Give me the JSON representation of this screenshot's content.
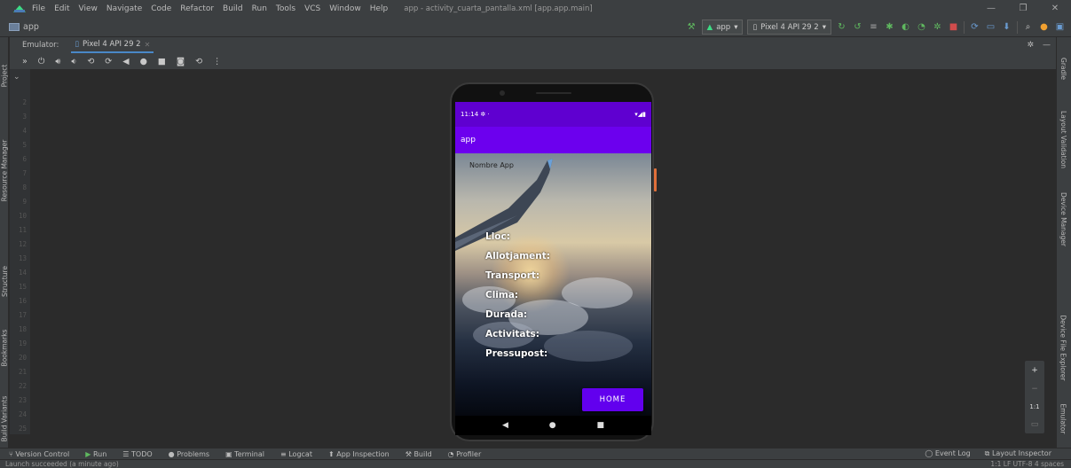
{
  "menubar": {
    "items": [
      "File",
      "Edit",
      "View",
      "Navigate",
      "Code",
      "Refactor",
      "Build",
      "Run",
      "Tools",
      "VCS",
      "Window",
      "Help"
    ],
    "window_title": "app - activity_cuarta_pantalla.xml [app.app.main]",
    "minimize": "—",
    "maximize": "❐",
    "close": "✕"
  },
  "navbar": {
    "project": "app",
    "run_config": "app",
    "device": "Pixel 4 API 29 2"
  },
  "left_tabs": [
    "Project",
    "Resource Manager",
    "Structure",
    "Bookmarks",
    "Build Variants"
  ],
  "right_tabs": [
    "Gradle",
    "Layout Validation",
    "Device Manager",
    "Device File Explorer",
    "Emulator"
  ],
  "emulator_tab": {
    "label": "Emulator:",
    "device_tab": "Pixel 4 API 29 2"
  },
  "gutter_lines": [
    "2",
    "3",
    "4",
    "5",
    "6",
    "7",
    "8",
    "9",
    "10",
    "11",
    "12",
    "13",
    "14",
    "15",
    "16",
    "17",
    "18",
    "19",
    "20",
    "21",
    "22",
    "23",
    "24",
    "25"
  ],
  "phone": {
    "time": "11:14",
    "app_title": "app",
    "nombre_app": "Nombre App",
    "fields": [
      "Lloc:",
      "Allotjament:",
      "Transport:",
      "Clima:",
      "Durada:",
      "Activitats:",
      "Pressupost:"
    ],
    "home_button": "HOME"
  },
  "zoom": {
    "plus": "+",
    "minus": "−",
    "ratio": "1:1"
  },
  "bottom_tools": [
    "Version Control",
    "Run",
    "TODO",
    "Problems",
    "Terminal",
    "Logcat",
    "App Inspection",
    "Build",
    "Profiler"
  ],
  "bottom_right": [
    "Event Log",
    "Layout Inspector"
  ],
  "status_message": "Launch succeeded (a minute ago)",
  "status_right": "1:1   LF   UTF-8   4 spaces"
}
